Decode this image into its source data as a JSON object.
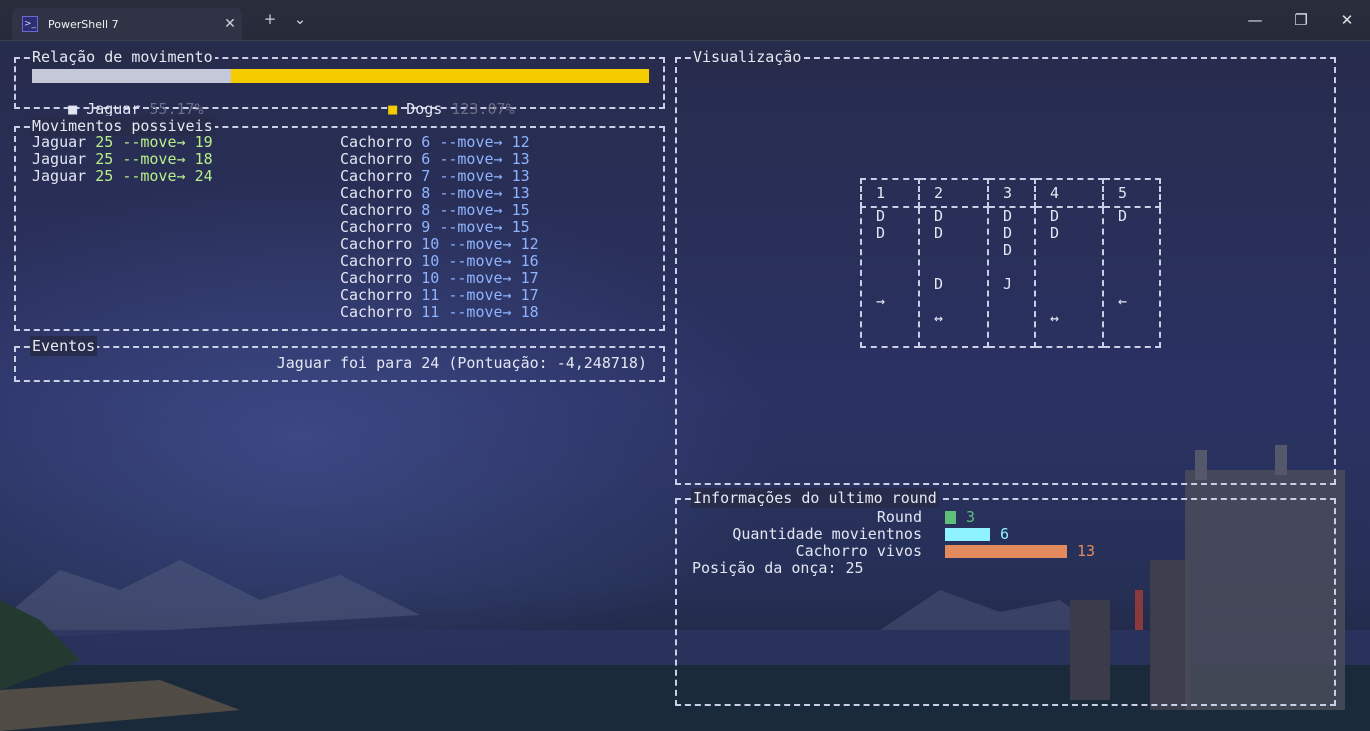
{
  "window": {
    "tab_title": "PowerShell 7",
    "tab_icon": "powershell-icon",
    "new_tab_label": "+",
    "dropdown_label": "⌄",
    "tab_close_label": "✕",
    "minimize_label": "—",
    "maximize_label": "❐",
    "close_label": "✕"
  },
  "relation": {
    "title": "Relação de movimento",
    "jaguar_label": "Jaguar",
    "jaguar_pct": "55.17%",
    "jaguar_fraction": 0.3225,
    "dogs_label": "Dogs",
    "dogs_pct": "123.07%",
    "jaguar_color": "#c4c8d8",
    "dogs_color": "#f5cc00"
  },
  "moves": {
    "title": "Movimentos possiveis",
    "arrow_text": "--move→",
    "jaguar": [
      {
        "name": "Jaguar",
        "from": "25",
        "to": "19"
      },
      {
        "name": "Jaguar",
        "from": "25",
        "to": "18"
      },
      {
        "name": "Jaguar",
        "from": "25",
        "to": "24"
      }
    ],
    "dogs": [
      {
        "name": "Cachorro",
        "from": "6",
        "to": "12"
      },
      {
        "name": "Cachorro",
        "from": "6",
        "to": "13"
      },
      {
        "name": "Cachorro",
        "from": "7",
        "to": "13"
      },
      {
        "name": "Cachorro",
        "from": "8",
        "to": "13"
      },
      {
        "name": "Cachorro",
        "from": "8",
        "to": "15"
      },
      {
        "name": "Cachorro",
        "from": "9",
        "to": "15"
      },
      {
        "name": "Cachorro",
        "from": "10",
        "to": "12"
      },
      {
        "name": "Cachorro",
        "from": "10",
        "to": "16"
      },
      {
        "name": "Cachorro",
        "from": "10",
        "to": "17"
      },
      {
        "name": "Cachorro",
        "from": "11",
        "to": "17"
      },
      {
        "name": "Cachorro",
        "from": "11",
        "to": "18"
      }
    ]
  },
  "events": {
    "title": "Eventos",
    "text": "Jaguar foi para 24 (Pontuação: -4,248718)"
  },
  "visual": {
    "title": "Visualização",
    "columns": [
      "1",
      "2",
      "3",
      "4",
      "5"
    ],
    "cells": [
      "D\nD\n\n\n\n→",
      "D\nD\n\n\nD\n\n↔",
      "D\nD\nD\n\nJ",
      "D\nD\n\n\n\n\n↔",
      "D\n\n\n\n\n←"
    ]
  },
  "round": {
    "title": "Informações do ultimo round",
    "round_label": "Round",
    "round_value": "3",
    "moves_label": "Quantidade movientnos",
    "moves_value": "6",
    "dogs_alive_label": "Cachorro vivos",
    "dogs_alive_value": "13",
    "position_label": "Posição da onça: 25",
    "round_color": "#5fbf7a",
    "moves_color": "#8ff3ff",
    "dogs_color": "#e38b5c"
  }
}
